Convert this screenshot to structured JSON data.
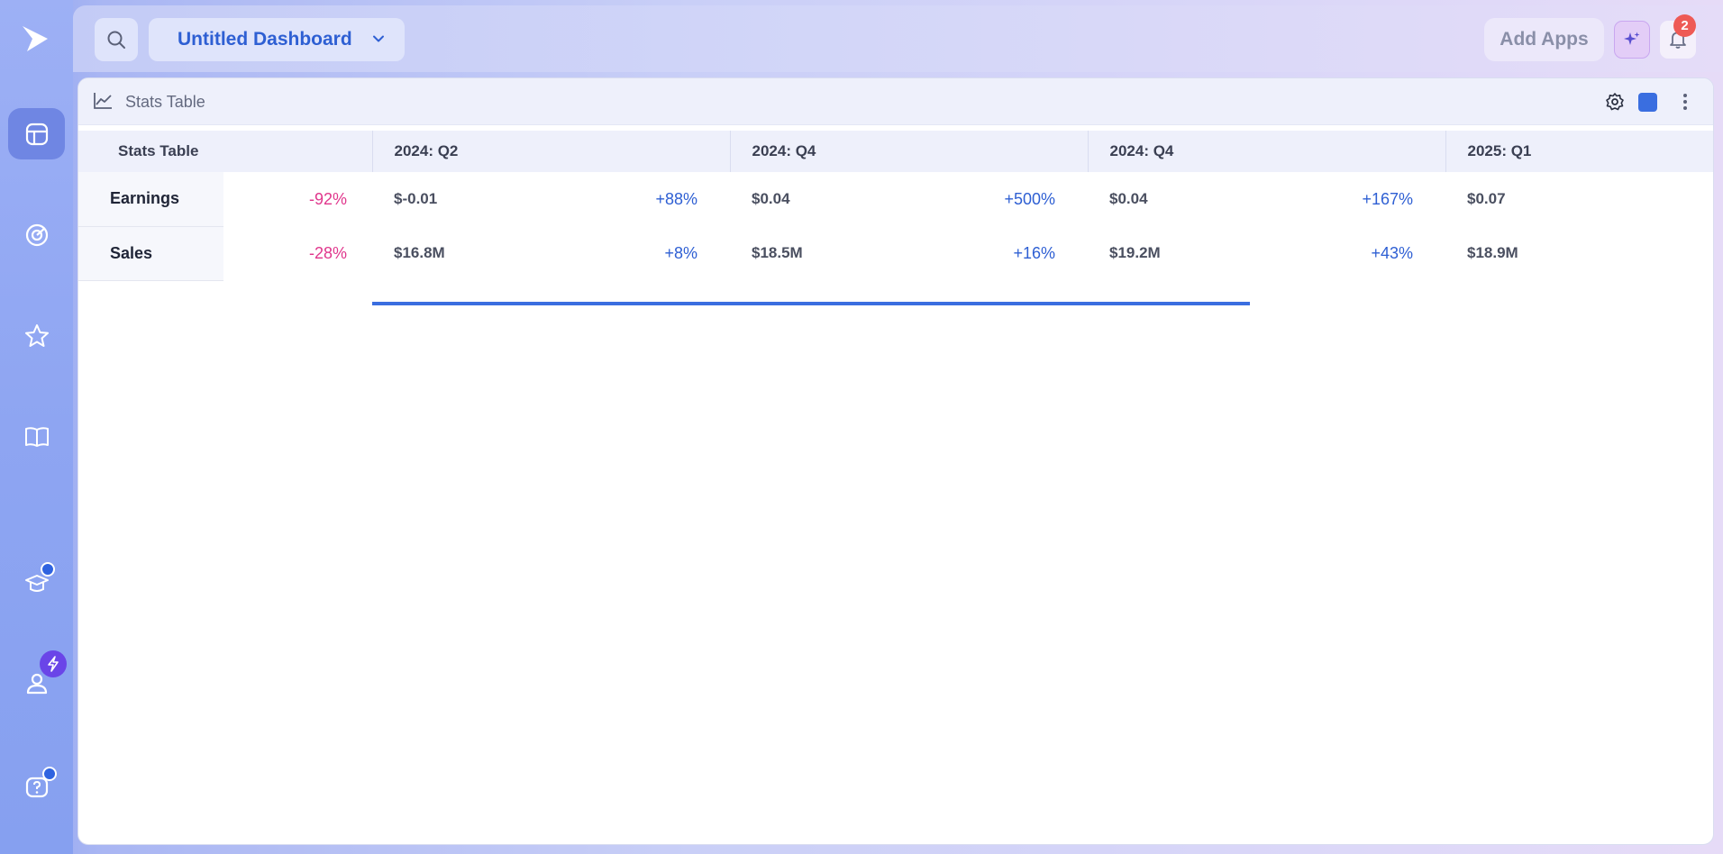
{
  "app": {
    "rail": {
      "items": [
        "dashboards",
        "activity",
        "favorites",
        "docs",
        "learn",
        "account",
        "help"
      ]
    }
  },
  "topbar": {
    "dashboard_name": "Untitled Dashboard",
    "add_apps_label": "Add Apps",
    "notification_count": "2"
  },
  "panel": {
    "title": "Stats Table",
    "accent_color": "#3a6ee0"
  },
  "table": {
    "corner_label": "Stats Table",
    "columns": [
      "2024: Q2",
      "2024: Q4",
      "2024: Q4",
      "2025: Q1"
    ],
    "rows": [
      {
        "label": "Earnings",
        "trend": "-92%",
        "cells": [
          {
            "value": "$-0.01",
            "change": "+88%"
          },
          {
            "value": "$0.04",
            "change": "+500%"
          },
          {
            "value": "$0.04",
            "change": "+167%"
          },
          {
            "value": "$0.07",
            "change": ""
          }
        ]
      },
      {
        "label": "Sales",
        "trend": "-28%",
        "cells": [
          {
            "value": "$16.8M",
            "change": "+8%"
          },
          {
            "value": "$18.5M",
            "change": "+16%"
          },
          {
            "value": "$19.2M",
            "change": "+43%"
          },
          {
            "value": "$18.9M",
            "change": ""
          }
        ]
      }
    ]
  }
}
